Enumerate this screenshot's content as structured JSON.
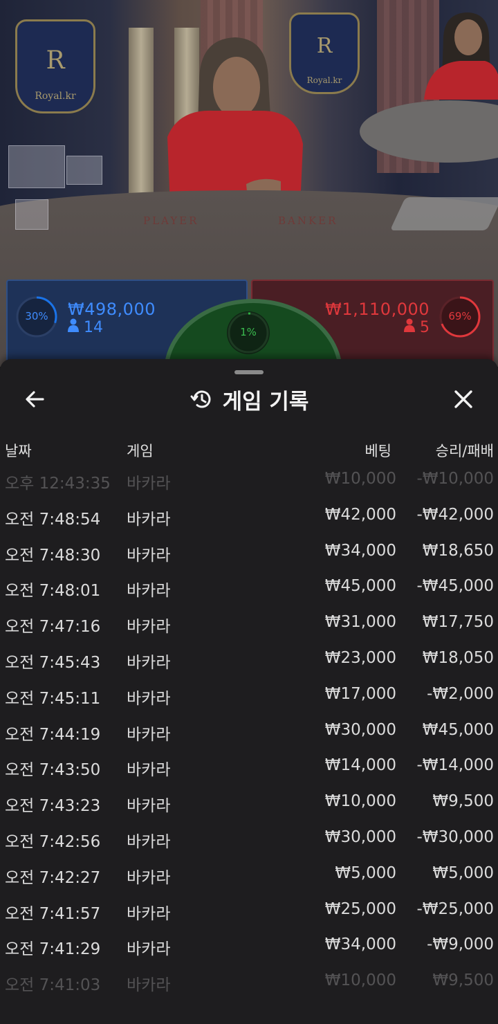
{
  "scene": {
    "crest_letter": "R",
    "crest_text": "Royal.kr",
    "table_player": "PLAYER",
    "table_banker": "BANKER"
  },
  "bets": {
    "player": {
      "percent": "30%",
      "percent_value": 30,
      "amount": "₩498,000",
      "count": "14",
      "color": "#1a73e8"
    },
    "tie": {
      "percent": "1%",
      "percent_value": 1,
      "color": "#2fb343"
    },
    "banker": {
      "percent": "69%",
      "percent_value": 69,
      "amount": "₩1,110,000",
      "count": "5",
      "color": "#d32f2f"
    }
  },
  "sheet": {
    "title": "게임 기록",
    "icons": {
      "back": "arrow-left-icon",
      "history": "history-icon",
      "close": "close-icon"
    },
    "headers": {
      "date": "날짜",
      "game": "게임",
      "bet": "베팅",
      "result": "승리/패배"
    },
    "rows": [
      {
        "date": "오후 12:43:35",
        "game": "바카라",
        "bet": "₩10,000",
        "result": "-₩10,000"
      },
      {
        "date": "오전 7:48:54",
        "game": "바카라",
        "bet": "₩42,000",
        "result": "-₩42,000"
      },
      {
        "date": "오전 7:48:30",
        "game": "바카라",
        "bet": "₩34,000",
        "result": "₩18,650"
      },
      {
        "date": "오전 7:48:01",
        "game": "바카라",
        "bet": "₩45,000",
        "result": "-₩45,000"
      },
      {
        "date": "오전 7:47:16",
        "game": "바카라",
        "bet": "₩31,000",
        "result": "₩17,750"
      },
      {
        "date": "오전 7:45:43",
        "game": "바카라",
        "bet": "₩23,000",
        "result": "₩18,050"
      },
      {
        "date": "오전 7:45:11",
        "game": "바카라",
        "bet": "₩17,000",
        "result": "-₩2,000"
      },
      {
        "date": "오전 7:44:19",
        "game": "바카라",
        "bet": "₩30,000",
        "result": "₩45,000"
      },
      {
        "date": "오전 7:43:50",
        "game": "바카라",
        "bet": "₩14,000",
        "result": "-₩14,000"
      },
      {
        "date": "오전 7:43:23",
        "game": "바카라",
        "bet": "₩10,000",
        "result": "₩9,500"
      },
      {
        "date": "오전 7:42:56",
        "game": "바카라",
        "bet": "₩30,000",
        "result": "-₩30,000"
      },
      {
        "date": "오전 7:42:27",
        "game": "바카라",
        "bet": "₩5,000",
        "result": "₩5,000"
      },
      {
        "date": "오전 7:41:57",
        "game": "바카라",
        "bet": "₩25,000",
        "result": "-₩25,000"
      },
      {
        "date": "오전 7:41:29",
        "game": "바카라",
        "bet": "₩34,000",
        "result": "-₩9,000"
      },
      {
        "date": "오전 7:41:03",
        "game": "바카라",
        "bet": "₩10,000",
        "result": "₩9,500"
      }
    ]
  }
}
